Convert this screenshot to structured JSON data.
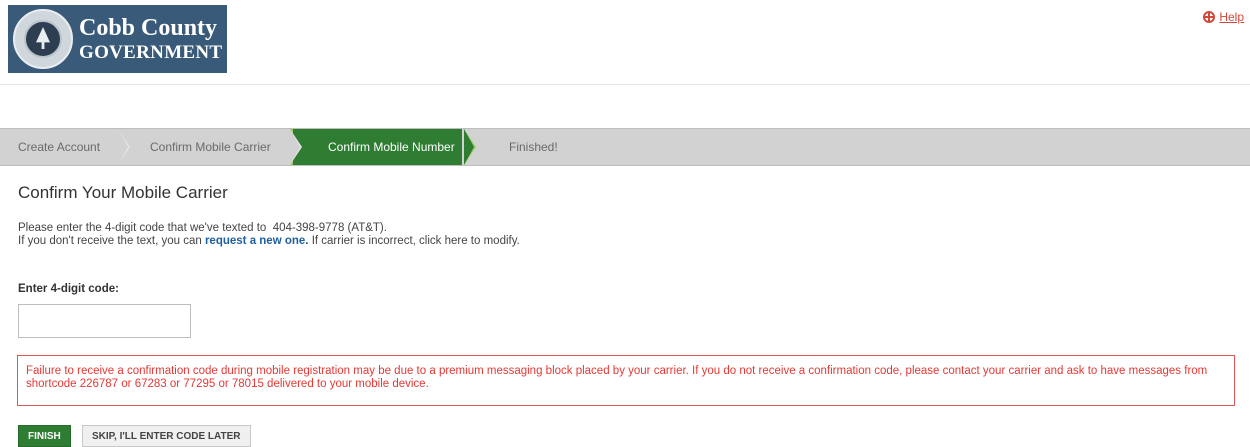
{
  "brand": {
    "line1": "Cobb County",
    "line2": "GOVERNMENT",
    "bg_color": "#3a5a7a"
  },
  "help": {
    "label": "Help",
    "icon": "lifebuoy-icon",
    "color": "#d0493a"
  },
  "steps": [
    {
      "label": "Create Account",
      "active": false
    },
    {
      "label": "Confirm Mobile Carrier",
      "active": false
    },
    {
      "label": "Confirm Mobile Number",
      "active": true
    },
    {
      "label": "Finished!",
      "active": false
    }
  ],
  "page": {
    "title": "Confirm Your Mobile Carrier",
    "intro_line1_prefix": "Please enter the 4-digit code that we've texted to",
    "phone": "404-398-9778",
    "carrier": "(AT&T).",
    "intro_line2_prefix": "If you don't receive the text, you can",
    "request_link": "request a new one.",
    "intro_line2_suffix": "If carrier is incorrect, click here to modify."
  },
  "code_field": {
    "label": "Enter 4-digit code:",
    "value": "",
    "placeholder": ""
  },
  "warning": {
    "text": "Failure to receive a confirmation code during mobile registration may be due to a premium messaging block placed by your carrier. If you do not receive a confirmation code, please contact your carrier and ask to have messages from shortcode 226787 or 67283 or 77295 or 78015 delivered to your mobile device.",
    "color": "#e53935"
  },
  "buttons": {
    "finish": "FINISH",
    "skip": "SKIP, I'LL ENTER CODE LATER"
  },
  "colors": {
    "active_step": "#2e7d32",
    "link": "#1f5f9f"
  }
}
